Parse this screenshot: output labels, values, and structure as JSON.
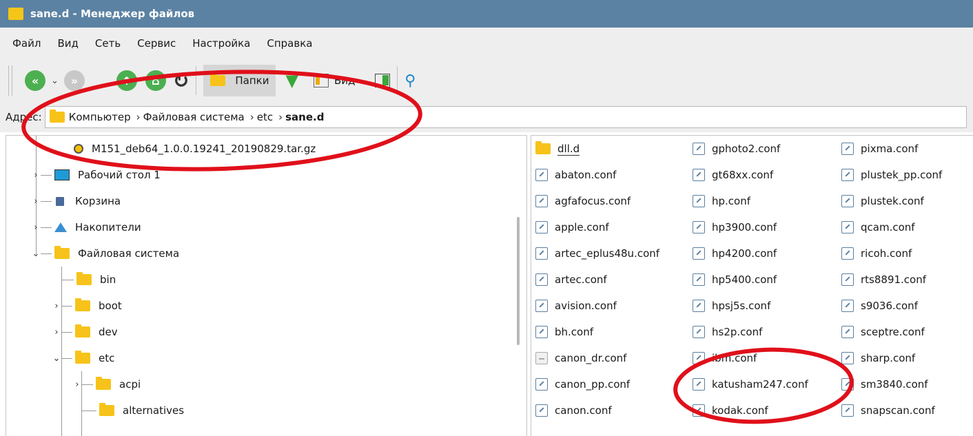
{
  "window": {
    "title": "sane.d - Менеджер файлов"
  },
  "menu": [
    "Файл",
    "Вид",
    "Сеть",
    "Сервис",
    "Настройка",
    "Справка"
  ],
  "toolbar": {
    "folders_label": "Папки",
    "view_label": "Вид"
  },
  "address": {
    "label": "Адрес:",
    "crumbs": [
      "Компьютер",
      "Файловая система",
      "etc",
      "sane.d"
    ]
  },
  "tree": [
    {
      "label": "M151_deb64_1.0.0.19241_20190829.tar.gz",
      "icon": "archive-icon",
      "expand": ""
    },
    {
      "label": "Рабочий стол 1",
      "icon": "desktop-icon",
      "expand": ">"
    },
    {
      "label": "Корзина",
      "icon": "trash-icon",
      "expand": ">"
    },
    {
      "label": "Накопители",
      "icon": "drives-icon",
      "expand": ">"
    },
    {
      "label": "Файловая система",
      "icon": "folder-icon",
      "expand": "v"
    },
    {
      "label": "bin",
      "icon": "folder-icon",
      "expand": ""
    },
    {
      "label": "boot",
      "icon": "folder-icon",
      "expand": ">"
    },
    {
      "label": "dev",
      "icon": "folder-icon",
      "expand": ">"
    },
    {
      "label": "etc",
      "icon": "folder-icon",
      "expand": "v"
    },
    {
      "label": "acpi",
      "icon": "folder-icon",
      "expand": ">"
    },
    {
      "label": "alternatives",
      "icon": "folder-icon",
      "expand": ""
    }
  ],
  "files": {
    "col1": [
      "dll.d",
      "abaton.conf",
      "agfafocus.conf",
      "apple.conf",
      "artec_eplus48u.conf",
      "artec.conf",
      "avision.conf",
      "bh.conf",
      "canon_dr.conf",
      "canon_pp.conf",
      "canon.conf"
    ],
    "col2": [
      "gphoto2.conf",
      "gt68xx.conf",
      "hp.conf",
      "hp3900.conf",
      "hp4200.conf",
      "hp5400.conf",
      "hpsj5s.conf",
      "hs2p.conf",
      "ibm.conf",
      "katusham247.conf",
      "kodak.conf"
    ],
    "col3": [
      "pixma.conf",
      "plustek_pp.conf",
      "plustek.conf",
      "qcam.conf",
      "ricoh.conf",
      "rts8891.conf",
      "s9036.conf",
      "sceptre.conf",
      "sharp.conf",
      "sm3840.conf",
      "snapscan.conf"
    ]
  },
  "colors": {
    "titlebar": "#5b82a3",
    "folder": "#f7c31a",
    "annotation": "#e0101a",
    "chrome": "#eeeeee"
  }
}
